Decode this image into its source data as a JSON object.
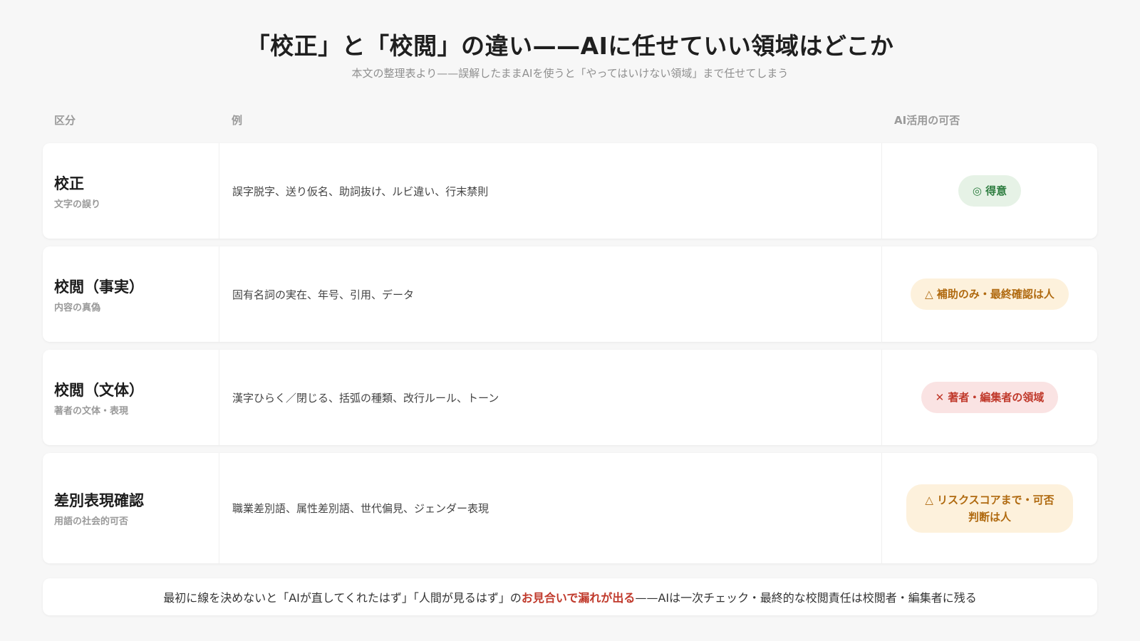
{
  "header": {
    "title": "「校正」と「校閲」の違い——AIに任せていい領域はどこか",
    "subtitle": "本文の整理表より——誤解したままAIを使うと「やってはいけない領域」まで任せてしまう"
  },
  "table": {
    "columns": [
      "区分",
      "例",
      "AI活用の可否"
    ],
    "rows": [
      {
        "category": "校正",
        "category_sub": "文字の誤り",
        "examples": "誤字脱字、送り仮名、助詞抜け、ルビ違い、行末禁則",
        "verdict": "◎ 得意",
        "verdict_status": "green"
      },
      {
        "category": "校閲（事実）",
        "category_sub": "内容の真偽",
        "examples": "固有名詞の実在、年号、引用、データ",
        "verdict": "△ 補助のみ・最終確認は人",
        "verdict_status": "amber"
      },
      {
        "category": "校閲（文体）",
        "category_sub": "著者の文体・表現",
        "examples": "漢字ひらく／閉じる、括弧の種類、改行ルール、トーン",
        "verdict": "✕ 著者・編集者の領域",
        "verdict_status": "red"
      },
      {
        "category": "差別表現確認",
        "category_sub": "用語の社会的可否",
        "examples": "職業差別語、属性差別語、世代偏見、ジェンダー表現",
        "verdict_line1": "△ リスクスコアまで・可否",
        "verdict_line2": "判断は人",
        "verdict_status": "amber"
      }
    ]
  },
  "footer": {
    "text_before": "最初に線を決めないと「AIが直してくれたはず」「人間が見るはず」の",
    "highlight": "お見合いで漏れが出る",
    "text_after": "——AIは一次チェック・最終的な校閲責任は校閲者・編集者に残る"
  },
  "colors": {
    "green": "#2e7d40",
    "amber": "#b06a10",
    "red": "#c0392b"
  }
}
